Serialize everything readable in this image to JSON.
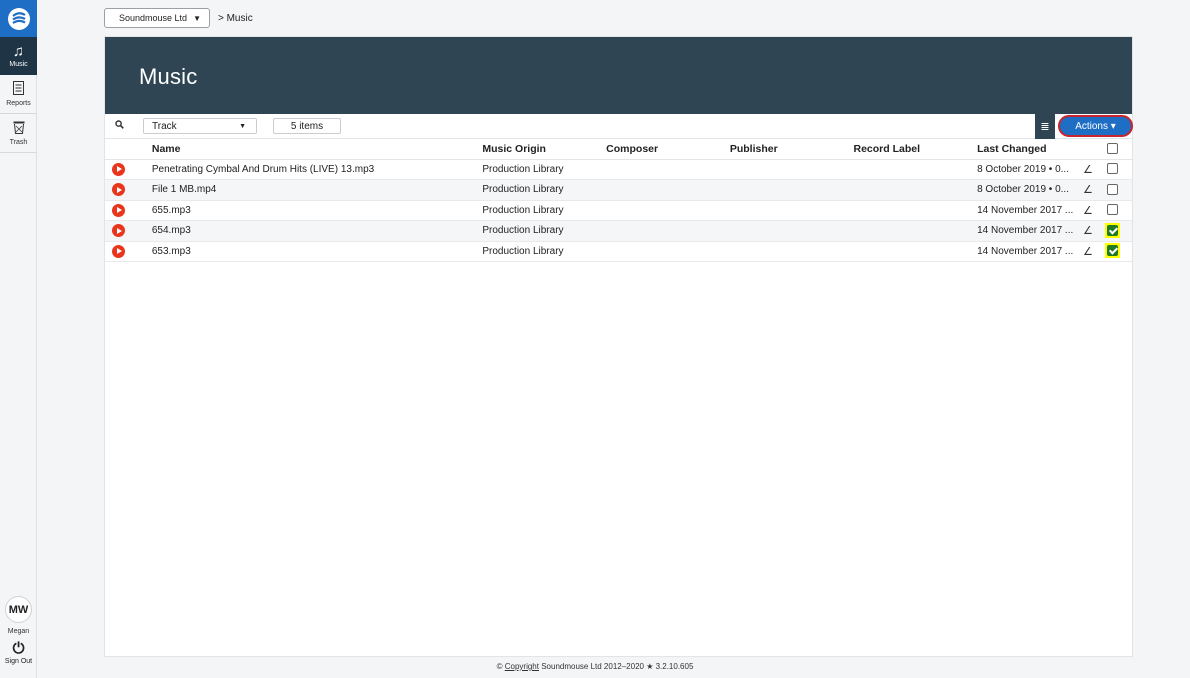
{
  "nav": {
    "items": [
      {
        "label": "Music",
        "icon": "music-note-icon"
      },
      {
        "label": "Reports",
        "icon": "reports-icon"
      },
      {
        "label": "Trash",
        "icon": "trash-icon"
      }
    ],
    "user_initials": "MW",
    "user_name": "Megan",
    "signout_label": "Sign Out"
  },
  "breadcrumb": {
    "org": "Soundmouse Ltd",
    "current": "> Music"
  },
  "page": {
    "title": "Music"
  },
  "toolbar": {
    "filter_value": "Track",
    "items_count": "5 items",
    "actions_label": "Actions ▾"
  },
  "table": {
    "headers": {
      "name": "Name",
      "origin": "Music Origin",
      "composer": "Composer",
      "publisher": "Publisher",
      "label": "Record Label",
      "changed": "Last Changed"
    },
    "rows": [
      {
        "name": "Penetrating Cymbal And Drum Hits (LIVE) 13.mp3",
        "origin": "Production Library",
        "composer": "",
        "publisher": "",
        "label": "",
        "changed": "8 October 2019 • 0...",
        "checked": false
      },
      {
        "name": "File 1 MB.mp4",
        "origin": "Production Library",
        "composer": "",
        "publisher": "",
        "label": "",
        "changed": "8 October 2019 • 0...",
        "checked": false
      },
      {
        "name": "655.mp3",
        "origin": "Production Library",
        "composer": "",
        "publisher": "",
        "label": "",
        "changed": "14 November 2017 ...",
        "checked": false
      },
      {
        "name": "654.mp3",
        "origin": "Production Library",
        "composer": "",
        "publisher": "",
        "label": "",
        "changed": "14 November 2017 ...",
        "checked": true
      },
      {
        "name": "653.mp3",
        "origin": "Production Library",
        "composer": "",
        "publisher": "",
        "label": "",
        "changed": "14 November 2017 ...",
        "checked": true
      }
    ]
  },
  "footer": {
    "copyright_symbol": "©",
    "copyright_link": "Copyright",
    "text": "Soundmouse Ltd 2012–2020 ★ 3.2.10.605"
  },
  "colors": {
    "brand_blue": "#1f6ec6",
    "hero_bg": "#2f4553",
    "play_red": "#e8351c",
    "highlight_yellow": "#ffff00",
    "check_green": "#1e7a25"
  }
}
